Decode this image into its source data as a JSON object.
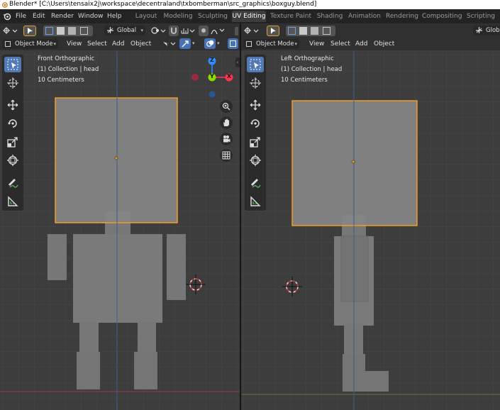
{
  "title_bar": {
    "text": "Blender* [C:\\Users\\tensaix2j\\workspace\\decentraland\\txbomberman\\src_graphics\\boxguy.blend]"
  },
  "menu": {
    "items": [
      "File",
      "Edit",
      "Render",
      "Window",
      "Help"
    ]
  },
  "workspaces": {
    "tabs": [
      "Layout",
      "Modeling",
      "Sculpting",
      "UV Editing",
      "Texture Paint",
      "Shading",
      "Animation",
      "Rendering",
      "Compositing",
      "Scripting"
    ],
    "active": "UV Editing"
  },
  "left_view": {
    "header": {
      "transform_orientation": "Global"
    },
    "mode": "Object Mode",
    "menus": [
      "View",
      "Select",
      "Add",
      "Object"
    ],
    "info": {
      "view_name": "Front Orthographic",
      "collection": "(1) Collection | head",
      "scale": "10 Centimeters"
    },
    "gizmo": {
      "z": "Z",
      "y": "Y",
      "x": "X"
    }
  },
  "right_view": {
    "header": {
      "transform_orientation": "Globa"
    },
    "mode": "Object Mode",
    "menus": [
      "View",
      "Select",
      "Add",
      "Object"
    ],
    "info": {
      "view_name": "Left Orthographic",
      "collection": "(1) Collection | head",
      "scale": "10 Centimeters"
    }
  },
  "colors": {
    "selection": "#f29d20",
    "grid_bg": "#3d3d3d",
    "mesh": "#7a7a7a",
    "active_tool": "#5379b4",
    "x_axis": "#ff3352",
    "y_axis": "#8bdc00",
    "z_axis": "#2c8fff"
  }
}
